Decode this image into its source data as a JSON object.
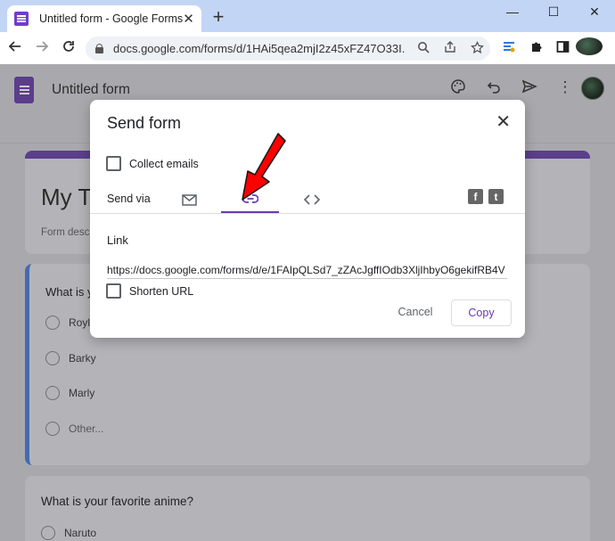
{
  "browser": {
    "tab_title": "Untitled form - Google Forms",
    "tab_close": "✕",
    "new_tab": "+",
    "window_controls": {
      "minimize": "—",
      "restore": "☐",
      "close": "✕"
    },
    "url": "docs.google.com/forms/d/1HAi5qea2mjI2z45xFZ47O33I..."
  },
  "app_header": {
    "doc_title": "Untitled form"
  },
  "background_form": {
    "title": "My T",
    "description": "Form desc",
    "q1_text": "What is y",
    "q1_options": [
      "Royle",
      "Barky",
      "Marly",
      "Other..."
    ],
    "q2_text": "What is your favorite anime?",
    "q2_options": [
      "Naruto"
    ]
  },
  "dialog": {
    "title": "Send form",
    "close_icon": "✕",
    "collect_emails_label": "Collect emails",
    "send_via_label": "Send via",
    "social": {
      "facebook": "f",
      "twitter": "t"
    },
    "link_heading": "Link",
    "link_url": "https://docs.google.com/forms/d/e/1FAIpQLSd7_zZAcJgffIOdb3XljIhbyO6gekifRB4V",
    "shorten_url_label": "Shorten URL",
    "cancel_label": "Cancel",
    "copy_label": "Copy"
  },
  "colors": {
    "forms_purple": "#673ab7",
    "annotation_red": "#ff0000"
  }
}
